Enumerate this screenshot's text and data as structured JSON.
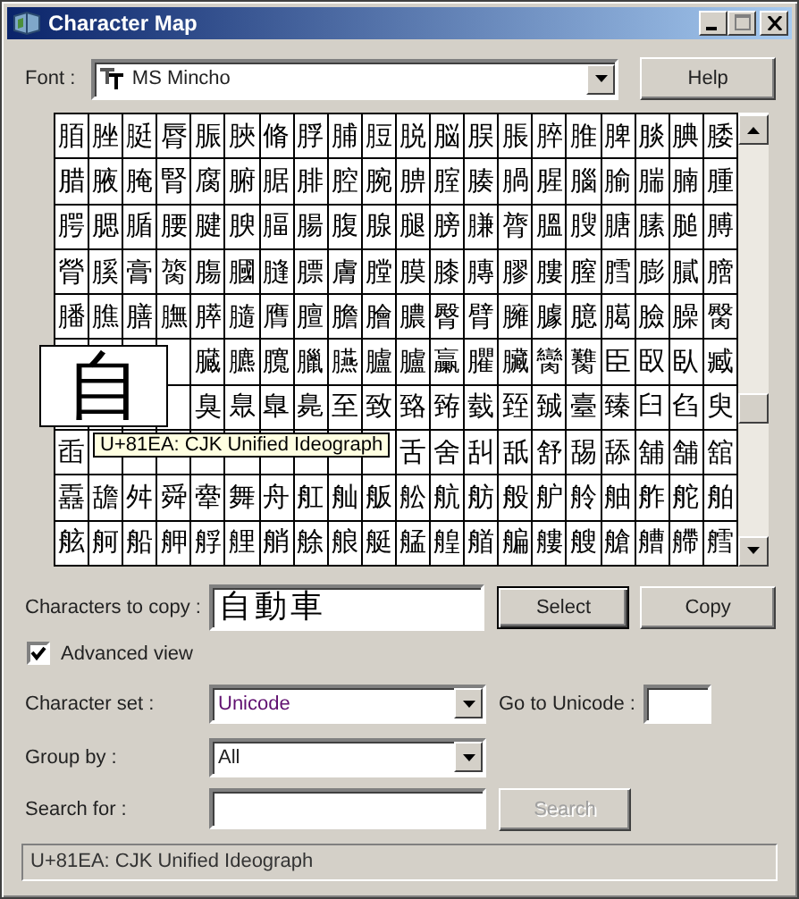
{
  "window": {
    "title": "Character Map"
  },
  "font": {
    "label": "Font :",
    "value": "MS Mincho"
  },
  "help_button": "Help",
  "grid": {
    "rows": [
      [
        "脜",
        "脞",
        "脡",
        "脣",
        "脤",
        "脥",
        "脩",
        "脬",
        "脯",
        "脰",
        "脱",
        "脳",
        "脵",
        "脹",
        "脺",
        "脽",
        "脾",
        "腅",
        "腆",
        "腇"
      ],
      [
        "腊",
        "腋",
        "腌",
        "腎",
        "腐",
        "腑",
        "腒",
        "腓",
        "腔",
        "腕",
        "腗",
        "腟",
        "腠",
        "腡",
        "腥",
        "腦",
        "腧",
        "腨",
        "腩",
        "腫"
      ],
      [
        "腭",
        "腮",
        "腯",
        "腰",
        "腱",
        "腴",
        "腷",
        "腸",
        "腹",
        "腺",
        "腿",
        "膀",
        "膁",
        "膂",
        "膃",
        "膄",
        "膅",
        "膆",
        "膇",
        "膊"
      ],
      [
        "膋",
        "膎",
        "膏",
        "膐",
        "膓",
        "膕",
        "膖",
        "膘",
        "膚",
        "膛",
        "膜",
        "膝",
        "膞",
        "膠",
        "膢",
        "膣",
        "膤",
        "膨",
        "膩",
        "膪"
      ],
      [
        "膰",
        "膲",
        "膳",
        "膴",
        "膵",
        "膸",
        "膺",
        "膻",
        "膽",
        "膾",
        "膿",
        "臀",
        "臂",
        "臃",
        "臄",
        "臆",
        "臈",
        "臉",
        "臊",
        "臋"
      ],
      [
        null,
        null,
        null,
        null,
        "臓",
        "臕",
        "臗",
        "臘",
        "臙",
        "臚",
        "臚",
        "臝",
        "臞",
        "臟",
        "臠",
        "臡",
        "臣",
        "臤",
        "臥",
        "臧"
      ],
      [
        null,
        null,
        null,
        null,
        "臭",
        "臮",
        "臯",
        "臰",
        "至",
        "致",
        "臵",
        "臶",
        "臷",
        "臸",
        "臹",
        "臺",
        "臻",
        "臼",
        "臽",
        "臾"
      ],
      [
        "臿",
        null,
        null,
        null,
        null,
        null,
        null,
        null,
        null,
        null,
        "舌",
        "舍",
        "舏",
        "舐",
        "舒",
        "舓",
        "舔",
        "舖",
        "舗",
        "舘"
      ],
      [
        "舙",
        "舚",
        "舛",
        "舜",
        "舝",
        "舞",
        "舟",
        "舡",
        "舢",
        "舨",
        "舩",
        "航",
        "舫",
        "般",
        "舮",
        "舲",
        "舳",
        "舴",
        "舵",
        "舶"
      ],
      [
        "舷",
        "舸",
        "船",
        "舺",
        "艀",
        "艃",
        "艄",
        "艅",
        "艆",
        "艇",
        "艋",
        "艎",
        "艏",
        "艑",
        "艛",
        "艘",
        "艙",
        "艚",
        "艜",
        "艝"
      ]
    ]
  },
  "magnifier": {
    "glyph": "自"
  },
  "tooltip": "U+81EA: CJK Unified Ideograph",
  "copy": {
    "label": "Characters to copy :",
    "value": "自動車"
  },
  "select_button": "Select",
  "copy_button": "Copy",
  "advanced_view": {
    "label": "Advanced view",
    "checked": true
  },
  "character_set": {
    "label": "Character set :",
    "value": "Unicode"
  },
  "go_to_unicode": {
    "label": "Go to Unicode :"
  },
  "group_by": {
    "label": "Group by :",
    "value": "All"
  },
  "search": {
    "label": "Search for :",
    "button": "Search",
    "disabled": true
  },
  "status_bar": "U+81EA: CJK Unified Ideograph"
}
